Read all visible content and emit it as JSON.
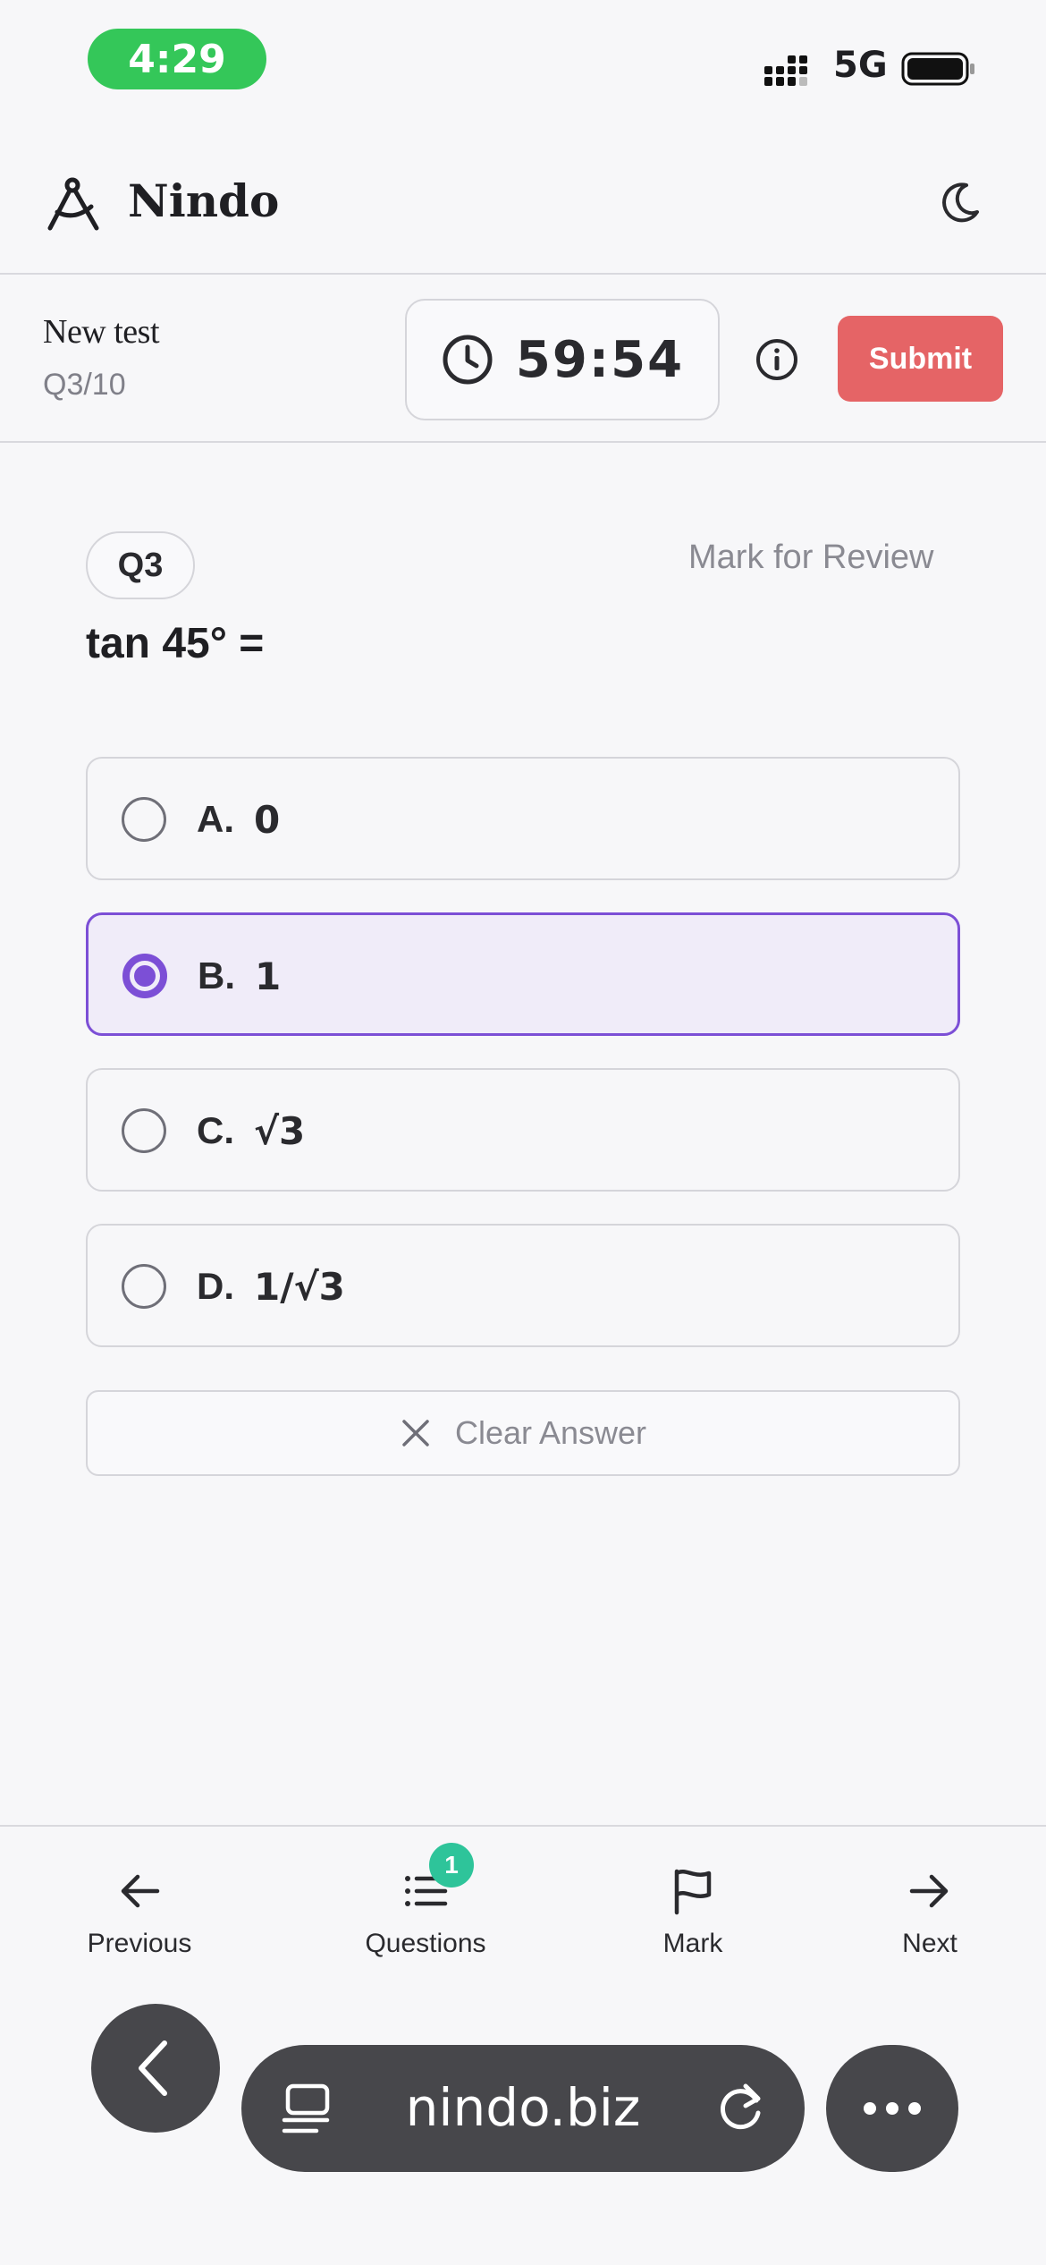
{
  "status_bar": {
    "time": "4:29",
    "network": "5G"
  },
  "header": {
    "brand": "Nindo"
  },
  "test": {
    "name": "New test",
    "progress": "Q3/10",
    "timer": "59:54",
    "submit_label": "Submit"
  },
  "question": {
    "badge": "Q3",
    "mark_review": "Mark for Review",
    "text": "tan 45° =",
    "options": [
      {
        "letter": "A.",
        "text": "0",
        "selected": false
      },
      {
        "letter": "B.",
        "text": "1",
        "selected": true
      },
      {
        "letter": "C.",
        "text": "√3",
        "selected": false
      },
      {
        "letter": "D.",
        "text": "1/√3",
        "selected": false
      }
    ],
    "clear_label": "Clear Answer"
  },
  "bottom_nav": {
    "items": [
      {
        "label": "Previous",
        "icon": "arrow-left-icon"
      },
      {
        "label": "Questions",
        "icon": "list-icon",
        "badge": "1"
      },
      {
        "label": "Mark",
        "icon": "flag-icon"
      },
      {
        "label": "Next",
        "icon": "arrow-right-icon"
      }
    ]
  },
  "browser": {
    "url": "nindo.biz"
  },
  "colors": {
    "accent": "#7c4fd6",
    "submit": "#e56466",
    "time_pill": "#34c759",
    "badge": "#2ec49a",
    "browser_controls": "#47474b"
  }
}
